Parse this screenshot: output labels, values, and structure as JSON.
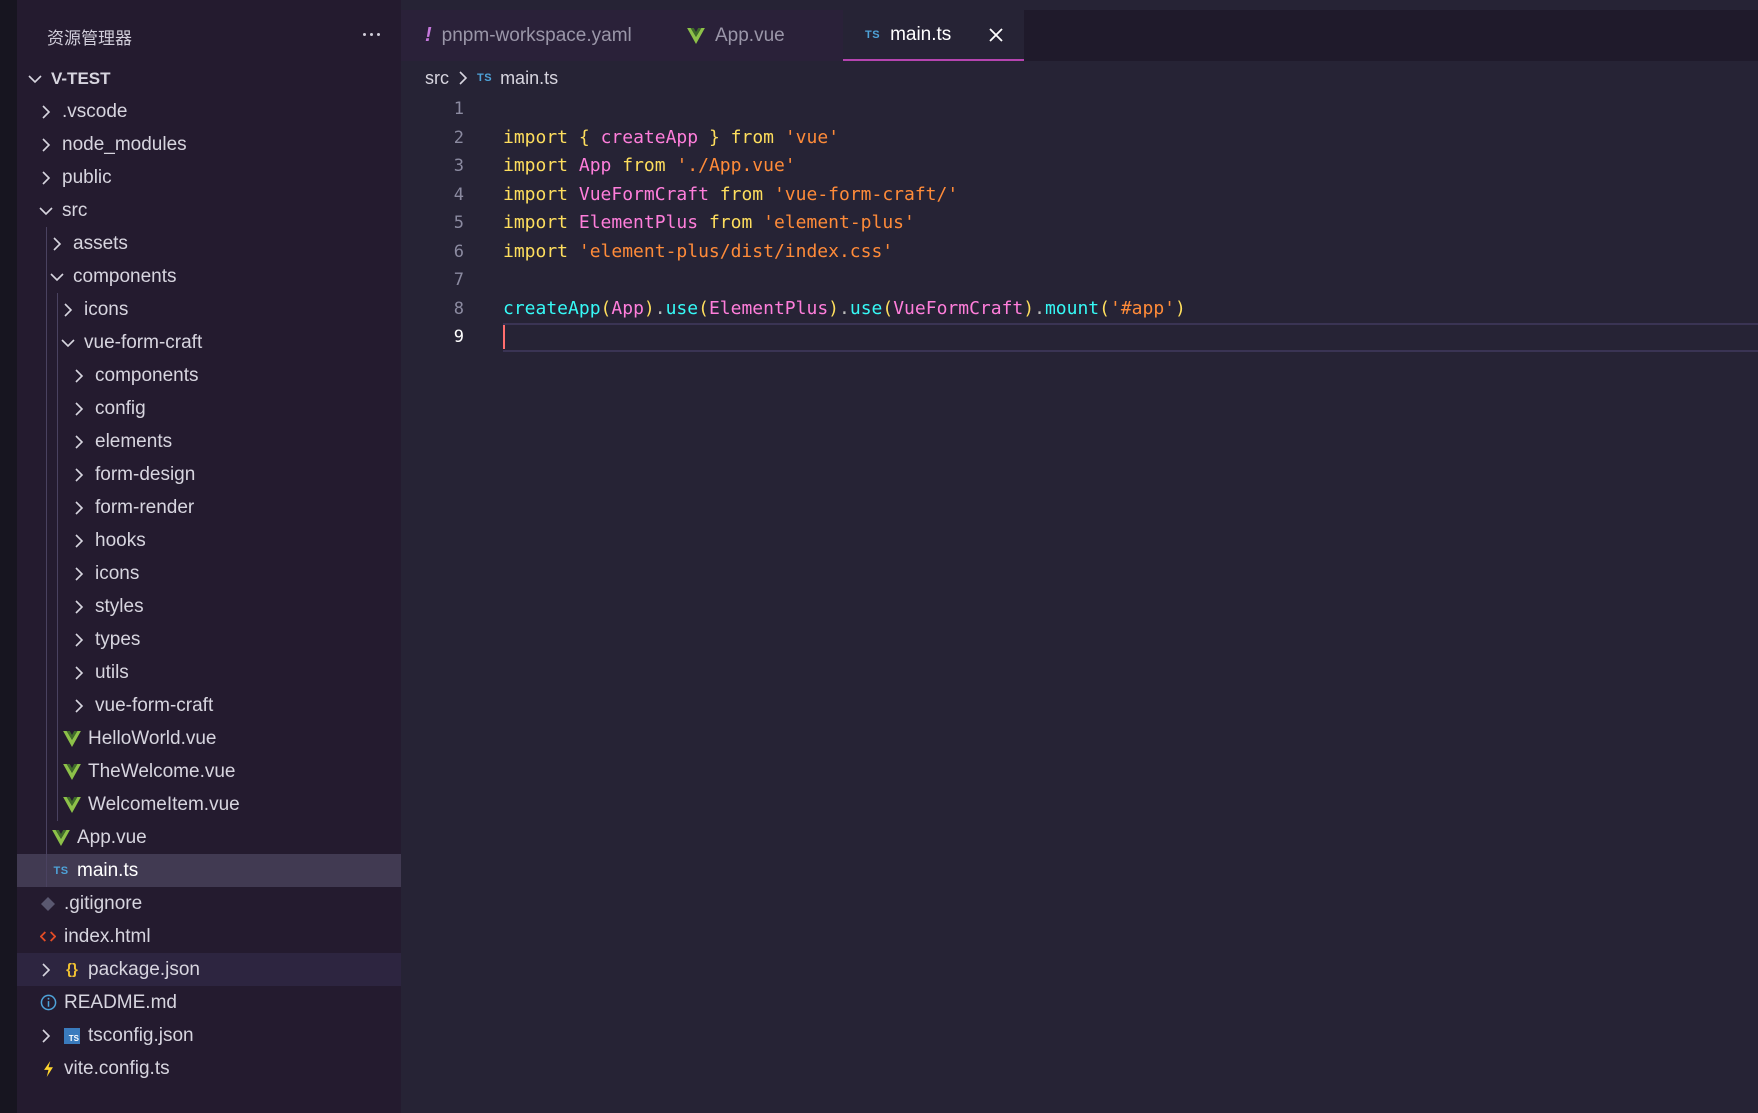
{
  "sidebar": {
    "title": "资源管理器",
    "more_label": "···",
    "items": [
      {
        "label": "V-TEST",
        "depth": 0,
        "kind": "folder",
        "expanded": true,
        "root": true
      },
      {
        "label": ".vscode",
        "depth": 1,
        "kind": "folder",
        "expanded": false
      },
      {
        "label": "node_modules",
        "depth": 1,
        "kind": "folder",
        "expanded": false
      },
      {
        "label": "public",
        "depth": 1,
        "kind": "folder",
        "expanded": false
      },
      {
        "label": "src",
        "depth": 1,
        "kind": "folder",
        "expanded": true
      },
      {
        "label": "assets",
        "depth": 2,
        "kind": "folder",
        "expanded": false
      },
      {
        "label": "components",
        "depth": 2,
        "kind": "folder",
        "expanded": true
      },
      {
        "label": "icons",
        "depth": 3,
        "kind": "folder",
        "expanded": false
      },
      {
        "label": "vue-form-craft",
        "depth": 3,
        "kind": "folder",
        "expanded": true
      },
      {
        "label": "components",
        "depth": 4,
        "kind": "folder",
        "expanded": false
      },
      {
        "label": "config",
        "depth": 4,
        "kind": "folder",
        "expanded": false
      },
      {
        "label": "elements",
        "depth": 4,
        "kind": "folder",
        "expanded": false
      },
      {
        "label": "form-design",
        "depth": 4,
        "kind": "folder",
        "expanded": false
      },
      {
        "label": "form-render",
        "depth": 4,
        "kind": "folder",
        "expanded": false
      },
      {
        "label": "hooks",
        "depth": 4,
        "kind": "folder",
        "expanded": false
      },
      {
        "label": "icons",
        "depth": 4,
        "kind": "folder",
        "expanded": false
      },
      {
        "label": "styles",
        "depth": 4,
        "kind": "folder",
        "expanded": false
      },
      {
        "label": "types",
        "depth": 4,
        "kind": "folder",
        "expanded": false
      },
      {
        "label": "utils",
        "depth": 4,
        "kind": "folder",
        "expanded": false
      },
      {
        "label": "vue-form-craft",
        "depth": 4,
        "kind": "folder",
        "expanded": false
      },
      {
        "label": "HelloWorld.vue",
        "depth": 3,
        "kind": "vue"
      },
      {
        "label": "TheWelcome.vue",
        "depth": 3,
        "kind": "vue"
      },
      {
        "label": "WelcomeItem.vue",
        "depth": 3,
        "kind": "vue"
      },
      {
        "label": "App.vue",
        "depth": 2,
        "kind": "vue"
      },
      {
        "label": "main.ts",
        "depth": 2,
        "kind": "ts",
        "selected": true
      },
      {
        "label": ".gitignore",
        "depth": 1,
        "kind": "git"
      },
      {
        "label": "index.html",
        "depth": 1,
        "kind": "html"
      },
      {
        "label": "package.json",
        "depth": 1,
        "kind": "json",
        "expanded": false,
        "hovered": true
      },
      {
        "label": "README.md",
        "depth": 1,
        "kind": "info"
      },
      {
        "label": "tsconfig.json",
        "depth": 1,
        "kind": "tsconfig",
        "expanded": false
      },
      {
        "label": "vite.config.ts",
        "depth": 1,
        "kind": "vite"
      }
    ]
  },
  "tabs": [
    {
      "label": "pnpm-workspace.yaml",
      "icon": "yaml-exclamation-icon",
      "active": false
    },
    {
      "label": "App.vue",
      "icon": "vue-icon",
      "active": false
    },
    {
      "label": "main.ts",
      "icon": "ts-icon",
      "icon_text": "TS",
      "active": true,
      "close_label": "✕"
    }
  ],
  "breadcrumb": {
    "folder": "src",
    "separator": ">",
    "icon_text": "TS",
    "file": "main.ts"
  },
  "editor": {
    "current_line": 9,
    "line_numbers": [
      "1",
      "2",
      "3",
      "4",
      "5",
      "6",
      "7",
      "8",
      "9"
    ],
    "lines": [
      [],
      [
        {
          "t": "import",
          "c": "k"
        },
        {
          "t": " "
        },
        {
          "t": "{",
          "c": "y"
        },
        {
          "t": " "
        },
        {
          "t": "createApp",
          "c": "v"
        },
        {
          "t": " "
        },
        {
          "t": "}",
          "c": "y"
        },
        {
          "t": " "
        },
        {
          "t": "from",
          "c": "k"
        },
        {
          "t": " "
        },
        {
          "t": "'vue'",
          "c": "s"
        }
      ],
      [
        {
          "t": "import",
          "c": "k"
        },
        {
          "t": " "
        },
        {
          "t": "App",
          "c": "v"
        },
        {
          "t": " "
        },
        {
          "t": "from",
          "c": "k"
        },
        {
          "t": " "
        },
        {
          "t": "'./App.vue'",
          "c": "s"
        }
      ],
      [
        {
          "t": "import",
          "c": "k"
        },
        {
          "t": " "
        },
        {
          "t": "VueFormCraft",
          "c": "v"
        },
        {
          "t": " "
        },
        {
          "t": "from",
          "c": "k"
        },
        {
          "t": " "
        },
        {
          "t": "'vue-form-craft/'",
          "c": "s"
        }
      ],
      [
        {
          "t": "import",
          "c": "k"
        },
        {
          "t": " "
        },
        {
          "t": "ElementPlus",
          "c": "v"
        },
        {
          "t": " "
        },
        {
          "t": "from",
          "c": "k"
        },
        {
          "t": " "
        },
        {
          "t": "'element-plus'",
          "c": "s"
        }
      ],
      [
        {
          "t": "import",
          "c": "k"
        },
        {
          "t": " "
        },
        {
          "t": "'element-plus/dist/index.css'",
          "c": "s"
        }
      ],
      [],
      [
        {
          "t": "createApp",
          "c": "f"
        },
        {
          "t": "(",
          "c": "y"
        },
        {
          "t": "App",
          "c": "v"
        },
        {
          "t": ")",
          "c": "y"
        },
        {
          "t": ".",
          "c": "p"
        },
        {
          "t": "use",
          "c": "f"
        },
        {
          "t": "(",
          "c": "y"
        },
        {
          "t": "ElementPlus",
          "c": "v"
        },
        {
          "t": ")",
          "c": "y"
        },
        {
          "t": ".",
          "c": "p"
        },
        {
          "t": "use",
          "c": "f"
        },
        {
          "t": "(",
          "c": "y"
        },
        {
          "t": "VueFormCraft",
          "c": "v"
        },
        {
          "t": ")",
          "c": "y"
        },
        {
          "t": ".",
          "c": "p"
        },
        {
          "t": "mount",
          "c": "f"
        },
        {
          "t": "(",
          "c": "y"
        },
        {
          "t": "'#app'",
          "c": "s"
        },
        {
          "t": ")",
          "c": "y"
        }
      ],
      []
    ]
  },
  "colors": {
    "sidebar_bg": "#241b2f",
    "editor_bg": "#262335",
    "selected_row": "#413a52",
    "vue_green": "#8dc149",
    "ts_blue": "#4ea2d8",
    "active_tab_border": "#b544b0"
  }
}
